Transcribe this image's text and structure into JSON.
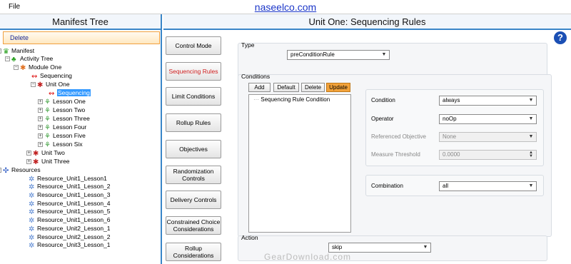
{
  "menu": {
    "file": "File"
  },
  "site_link": "naseelco.com",
  "left_panel": {
    "title": "Manifest Tree",
    "delete_label": "Delete"
  },
  "tree": [
    {
      "label": "Manifest",
      "icon": "manifest-crown-icon",
      "color": "#2aa020"
    },
    {
      "label": "Activity Tree",
      "icon": "activity-tree-icon",
      "color": "#2aa020"
    },
    {
      "label": "Module One",
      "icon": "module-icon",
      "color": "#e07020"
    },
    {
      "label": "Sequencing",
      "icon": "sequencing-icon",
      "color": "#e02020"
    },
    {
      "label": "Unit One",
      "icon": "unit-icon",
      "color": "#c02020"
    },
    {
      "label": "Sequencing",
      "icon": "sequencing-icon",
      "color": "#e02020",
      "selected": true
    },
    {
      "label": "Lesson One",
      "icon": "lesson-icon",
      "color": "#40a040"
    },
    {
      "label": "Lesson Two",
      "icon": "lesson-icon",
      "color": "#40a040"
    },
    {
      "label": "Lesson Three",
      "icon": "lesson-icon",
      "color": "#40a040"
    },
    {
      "label": "Lesson Four",
      "icon": "lesson-icon",
      "color": "#40a040"
    },
    {
      "label": "Lesson Five",
      "icon": "lesson-icon",
      "color": "#40a040"
    },
    {
      "label": "Lesson Six",
      "icon": "lesson-icon",
      "color": "#40a040"
    },
    {
      "label": "Unit Two",
      "icon": "unit-icon",
      "color": "#c02020"
    },
    {
      "label": "Unit Three",
      "icon": "unit-icon",
      "color": "#c02020"
    },
    {
      "label": "Resources",
      "icon": "resources-icon",
      "color": "#2050c0"
    },
    {
      "label": "Resource_Unit1_Lesson1",
      "icon": "resource-star-icon",
      "color": "#5080d0"
    },
    {
      "label": "Resource_Unit1_Lesson_2",
      "icon": "resource-star-icon",
      "color": "#5080d0"
    },
    {
      "label": "Resource_Unit1_Lesson_3",
      "icon": "resource-star-icon",
      "color": "#5080d0"
    },
    {
      "label": "Resource_Unit1_Lesson_4",
      "icon": "resource-star-icon",
      "color": "#5080d0"
    },
    {
      "label": "Resource_Unit1_Lesson_5",
      "icon": "resource-star-icon",
      "color": "#5080d0"
    },
    {
      "label": "Resource_Unit1_Lesson_6",
      "icon": "resource-star-icon",
      "color": "#5080d0"
    },
    {
      "label": "Resource_Unit2_Lesson_1",
      "icon": "resource-star-icon",
      "color": "#5080d0"
    },
    {
      "label": "Resource_Unit2_Lesson_2",
      "icon": "resource-star-icon",
      "color": "#5080d0"
    },
    {
      "label": "Resource_Unit3_Lesson_1",
      "icon": "resource-star-icon",
      "color": "#5080d0"
    }
  ],
  "main": {
    "title": "Unit One: Sequencing Rules",
    "help_icon": "?",
    "nav": [
      {
        "label": "Control Mode"
      },
      {
        "label": "Sequencing Rules",
        "active": true
      },
      {
        "label": "Limit Conditions"
      },
      {
        "label": "Rollup Rules"
      },
      {
        "label": "Objectives"
      },
      {
        "label": "Randomization Controls"
      },
      {
        "label": "Delivery Controls"
      },
      {
        "label": "Constrained Choice Considerations"
      },
      {
        "label": "Rollup Considerations"
      }
    ],
    "type": {
      "title": "Type",
      "value": "preConditionRule"
    },
    "conditions": {
      "title": "Conditions",
      "buttons": [
        "Add",
        "Default",
        "Delete",
        "Update"
      ],
      "list_item": "Sequencing Rule Condition",
      "condition_label": "Condition",
      "condition_value": "always",
      "operator_label": "Operator",
      "operator_value": "noOp",
      "ref_obj_label": "Referenced Objective",
      "ref_obj_value": "None",
      "measure_label": "Measure Threshold",
      "measure_value": "0.0000",
      "combination_label": "Combination",
      "combination_value": "all"
    },
    "action": {
      "title": "Action",
      "value": "skip"
    }
  },
  "watermark": "GearDownload.com"
}
